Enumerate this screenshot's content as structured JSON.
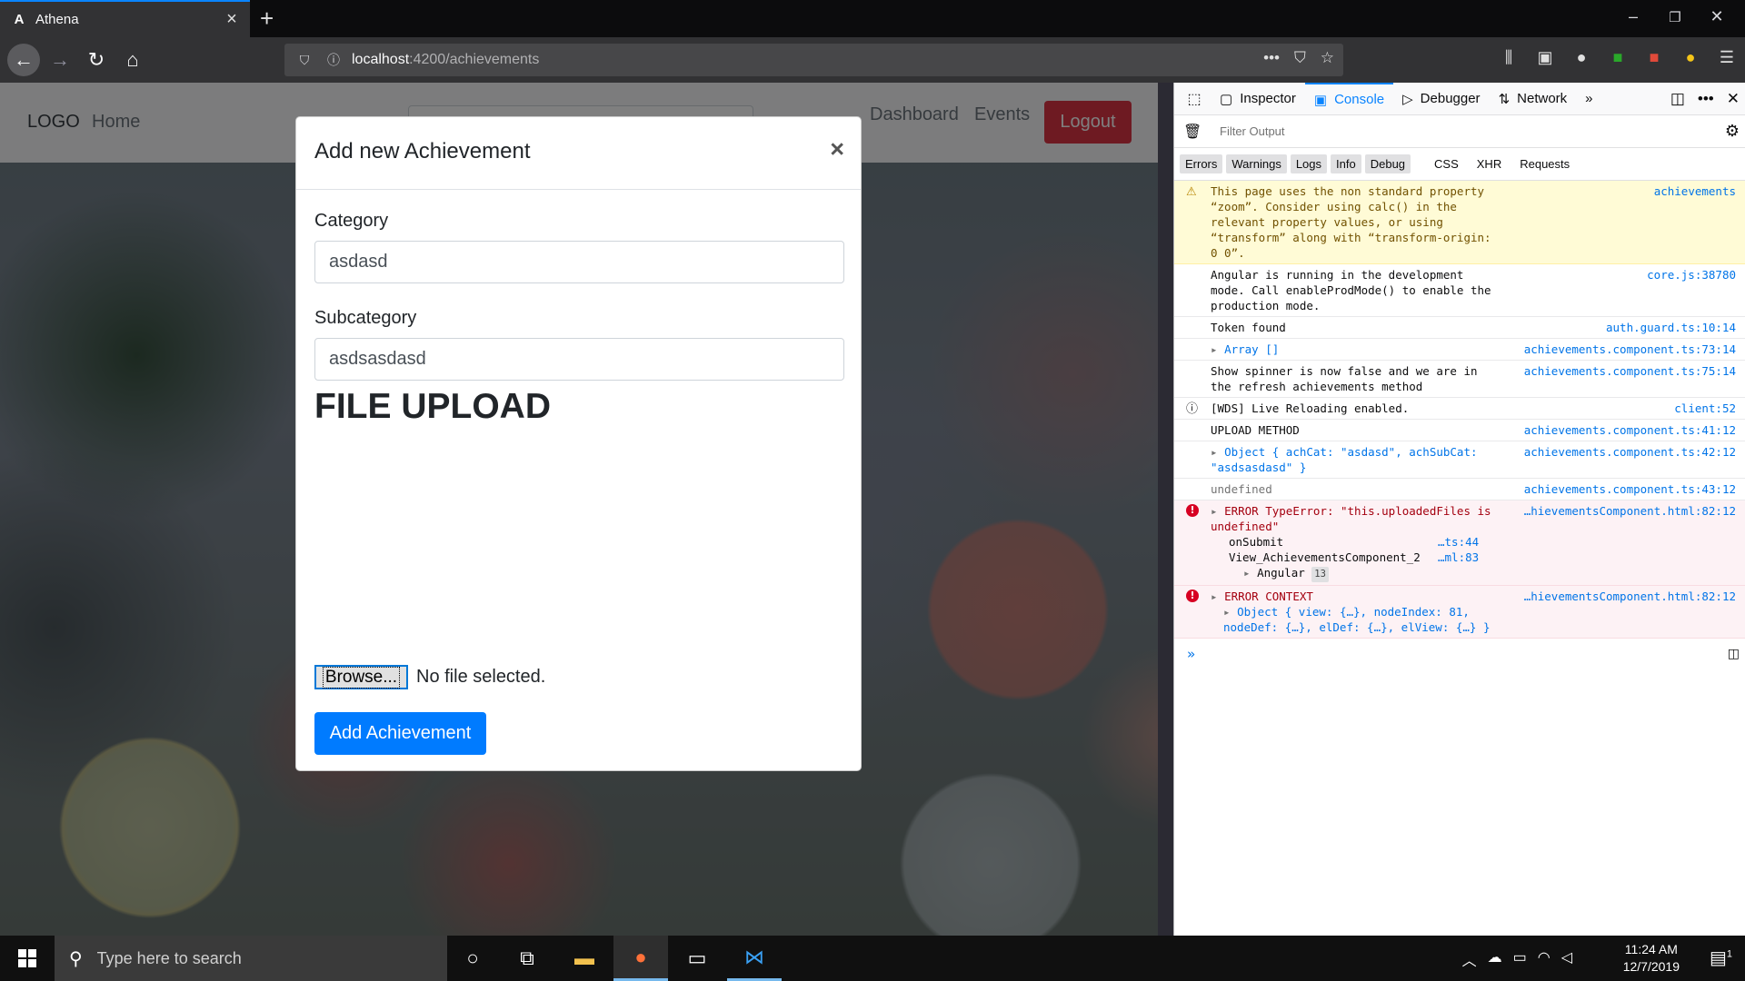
{
  "browser": {
    "tab_title": "Athena",
    "tab_favicon": "A",
    "tab_close": "×",
    "new_tab": "+",
    "url_host": "localhost",
    "url_path": ":4200/achievements",
    "window_controls": [
      "–",
      "❐",
      "✕"
    ]
  },
  "app": {
    "logo": "LOGO",
    "home": "Home",
    "dashboard": "Dashboard",
    "events": "Events",
    "logout": "Logout"
  },
  "modal": {
    "title": "Add new Achievement",
    "close": "×",
    "category_label": "Category",
    "category_value": "asdasd",
    "subcategory_label": "Subcategory",
    "subcategory_value": "asdsasdasd",
    "file_upload_title": "FILE UPLOAD",
    "browse_label": "Browse...",
    "file_status": "No file selected.",
    "submit_label": "Add Achievement"
  },
  "devtools": {
    "tabs": [
      "Inspector",
      "Console",
      "Debugger",
      "Network"
    ],
    "active_tab": "Console",
    "filter_placeholder": "Filter Output",
    "levels": [
      "Errors",
      "Warnings",
      "Logs",
      "Info",
      "Debug"
    ],
    "types": [
      "CSS",
      "XHR",
      "Requests"
    ],
    "messages": [
      {
        "kind": "warn",
        "text": "This page uses the non standard property “zoom”. Consider using calc() in the relevant property values, or using “transform” along with “transform-origin: 0 0”.",
        "source": "achievements"
      },
      {
        "kind": "log",
        "text": "Angular is running in the development mode. Call enableProdMode() to enable the production mode.",
        "source": "core.js:38780"
      },
      {
        "kind": "log",
        "text": "Token found",
        "source": "auth.guard.ts:10:14"
      },
      {
        "kind": "log",
        "text": "Array []",
        "source": "achievements.component.ts:73:14"
      },
      {
        "kind": "log",
        "text": "Show spinner is now false and we are in the refresh achievements method",
        "source": "achievements.component.ts:75:14"
      },
      {
        "kind": "info",
        "text": "[WDS] Live Reloading enabled.",
        "source": "client:52"
      },
      {
        "kind": "log",
        "text": "UPLOAD METHOD",
        "source": "achievements.component.ts:41:12"
      },
      {
        "kind": "log",
        "text": "Object { achCat: \"asdasd\", achSubCat: \"asdsasdasd\" }",
        "source": "achievements.component.ts:42:12"
      },
      {
        "kind": "log",
        "text": "undefined",
        "source": "achievements.component.ts:43:12"
      },
      {
        "kind": "error",
        "text": "ERROR TypeError: \"this.uploadedFiles is undefined\"",
        "source": "…hievementsComponent.html:82:12",
        "stack": [
          {
            "fn": "onSubmit",
            "loc": "…ts:44"
          },
          {
            "fn": "View_AchievementsComponent_2",
            "loc": "…ml:83"
          }
        ],
        "group": "Angular",
        "group_count": "13"
      },
      {
        "kind": "error",
        "text": "ERROR CONTEXT",
        "source": "…hievementsComponent.html:82:12",
        "detail": "Object { view: {…}, nodeIndex: 81, nodeDef: {…}, elDef: {…}, elView: {…} }"
      }
    ],
    "prompt": "»"
  },
  "taskbar": {
    "search_placeholder": "Type here to search",
    "time": "11:24 AM",
    "date": "12/7/2019",
    "notification_count": "1"
  },
  "colors": {
    "accent": "#0a84ff",
    "logout": "#dc3545",
    "primary_button": "#007bff"
  }
}
